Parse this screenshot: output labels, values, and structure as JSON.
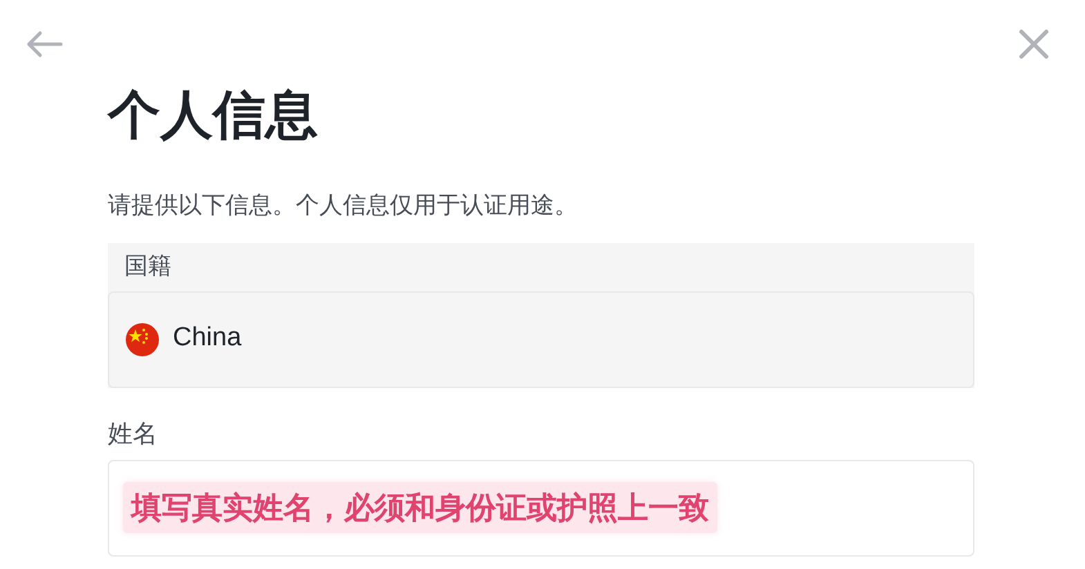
{
  "title": "个人信息",
  "description": "请提供以下信息。个人信息仅用于认证用途。",
  "nationality": {
    "label": "国籍",
    "value": "China"
  },
  "name": {
    "label": "姓名",
    "note": "填写真实姓名，必须和身份证或护照上一致"
  }
}
